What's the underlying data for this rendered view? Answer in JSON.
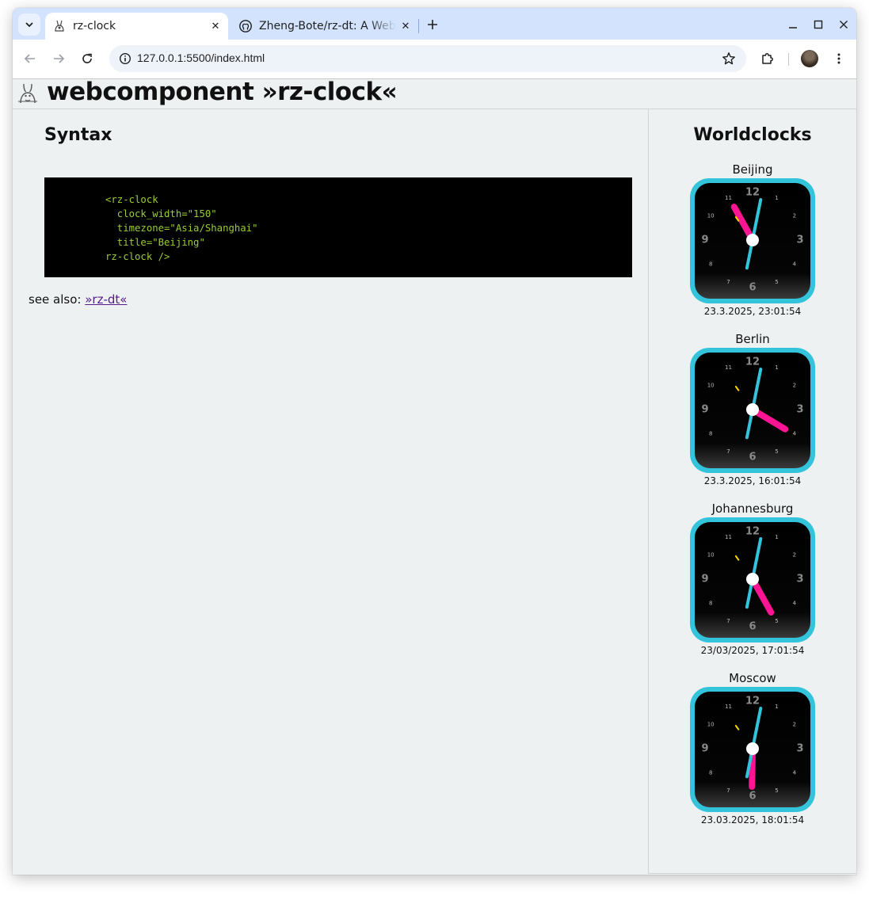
{
  "browser": {
    "tabs": [
      {
        "title": "rz-clock",
        "active": true
      },
      {
        "title": "Zheng-Bote/rz-dt: A Web",
        "active": false
      }
    ],
    "url": "127.0.0.1:5500/index.html"
  },
  "page": {
    "title": "webcomponent »rz-clock«",
    "syntax_heading": "Syntax",
    "code": "<rz-clock\n  clock_width=\"150\"\n  timezone=\"Asia/Shanghai\"\n  title=\"Beijing\"\nrz-clock />",
    "see_also_label": "see also:",
    "see_also_link": "»rz-dt«"
  },
  "sidebar": {
    "title": "Worldclocks",
    "clocks": [
      {
        "name": "Beijing",
        "datetime": "23.3.2025, 23:01:54",
        "hour": 23,
        "minute": 1,
        "second": 54
      },
      {
        "name": "Berlin",
        "datetime": "23.3.2025, 16:01:54",
        "hour": 16,
        "minute": 1,
        "second": 54
      },
      {
        "name": "Johannesburg",
        "datetime": "23/03/2025, 17:01:54",
        "hour": 17,
        "minute": 1,
        "second": 54
      },
      {
        "name": "Moscow",
        "datetime": "23.03.2025, 18:01:54",
        "hour": 18,
        "minute": 1,
        "second": 54
      }
    ],
    "clock_numerals": [
      "12",
      "1",
      "2",
      "3",
      "4",
      "5",
      "6",
      "7",
      "8",
      "9",
      "10",
      "11"
    ]
  },
  "colors": {
    "clock_bezel": "#33c4dc",
    "hour_hand": "#ff1493",
    "minute_hand": "#33c4dc",
    "second_hand": "#f2d500",
    "code_text": "#9acd32",
    "tabstrip": "#d3e3fd"
  },
  "icons": {
    "tab_search": "chevron-down-icon",
    "back": "arrow-left-icon",
    "forward": "arrow-right-icon",
    "reload": "reload-icon",
    "site_info": "info-icon",
    "bookmark": "star-icon",
    "extensions": "puzzle-icon",
    "menu": "kebab-menu-icon",
    "minimize": "minimize-icon",
    "maximize": "maximize-icon",
    "close": "close-icon",
    "github": "github-icon",
    "logo": "rabbit-logo-icon"
  }
}
